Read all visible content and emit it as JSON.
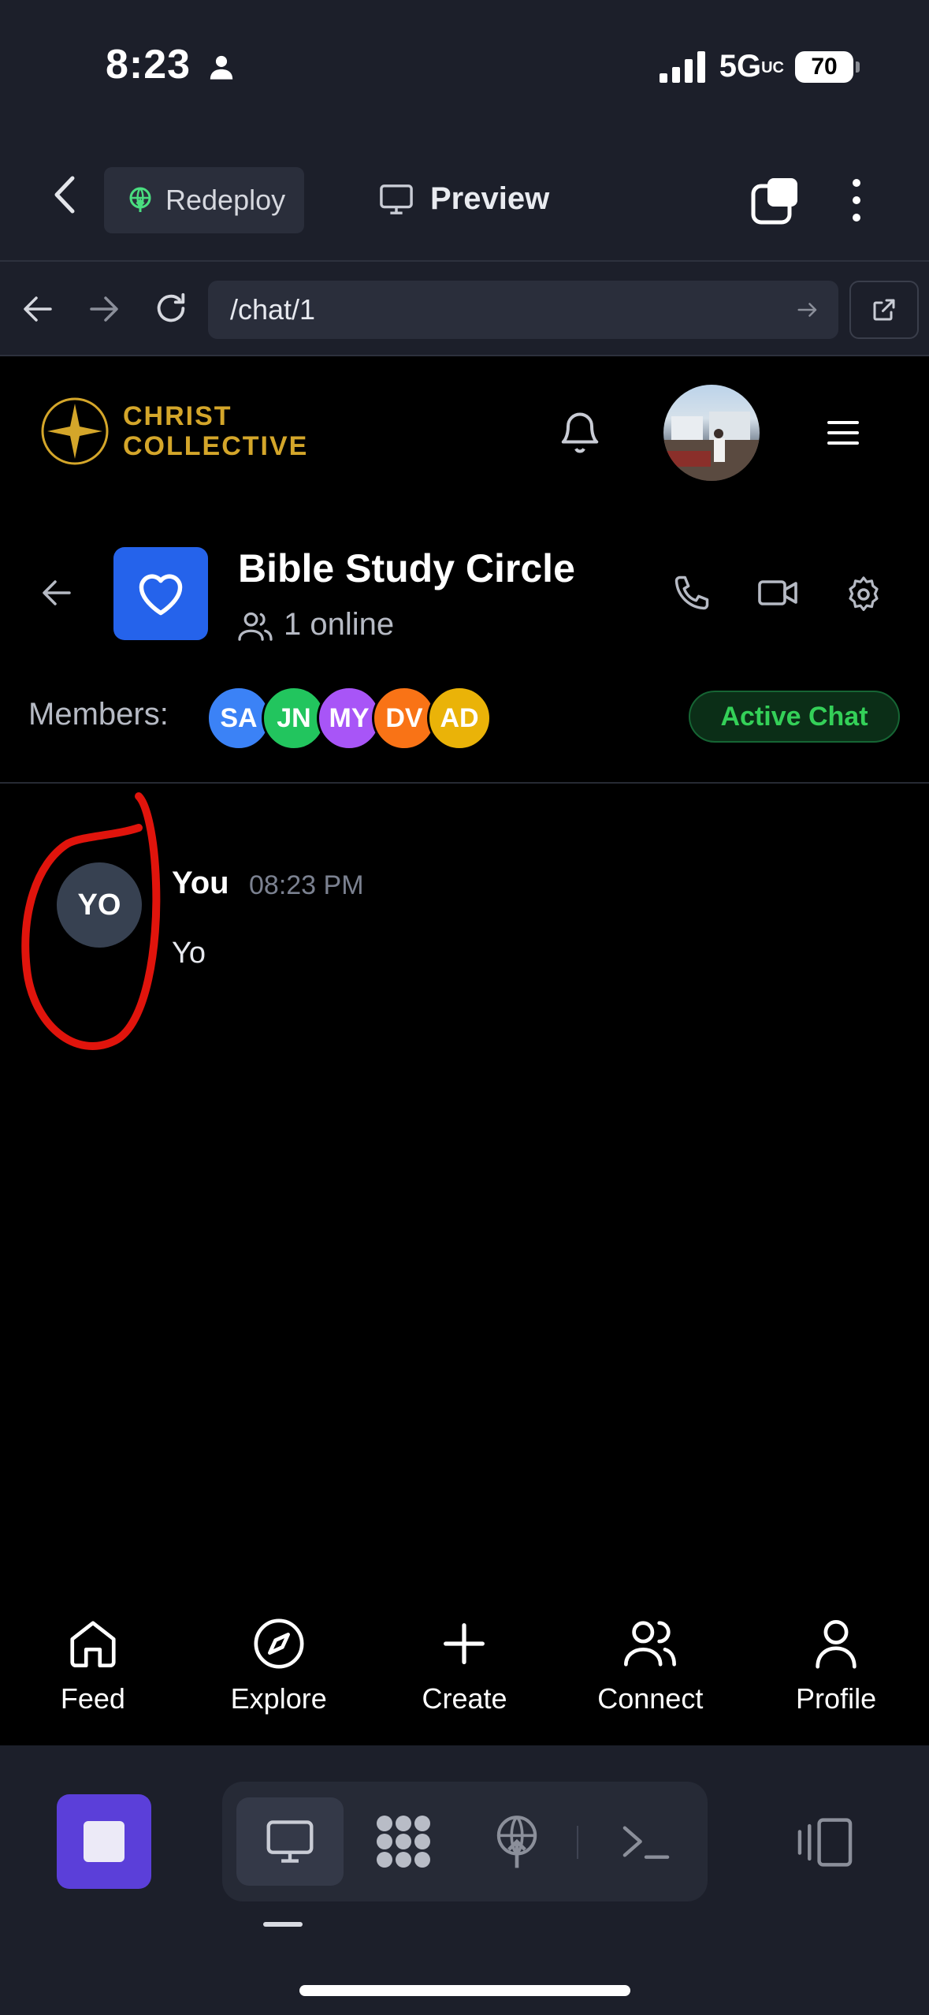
{
  "status_bar": {
    "time": "8:23",
    "network": "5G",
    "network_suffix": "UC",
    "battery": "70"
  },
  "toolbar": {
    "redeploy_label": "Redeploy",
    "preview_label": "Preview"
  },
  "browser": {
    "url": "/chat/1"
  },
  "app_header": {
    "logo_line1": "CHRIST",
    "logo_line2": "COLLECTIVE",
    "brand_color": "#d4a62a"
  },
  "chat": {
    "title": "Bible Study Circle",
    "online_text": "1 online",
    "members_label": "Members:",
    "members": [
      {
        "initials": "SA",
        "color": "#3b82f6"
      },
      {
        "initials": "JN",
        "color": "#22c55e"
      },
      {
        "initials": "MY",
        "color": "#a855f7"
      },
      {
        "initials": "DV",
        "color": "#f97316"
      },
      {
        "initials": "AD",
        "color": "#eab308"
      }
    ],
    "status_badge": "Active Chat"
  },
  "messages": [
    {
      "avatar": "YO",
      "sender": "You",
      "time": "08:23 PM",
      "text": "Yo"
    }
  ],
  "bottom_nav": [
    {
      "label": "Feed",
      "icon": "home-icon"
    },
    {
      "label": "Explore",
      "icon": "compass-icon"
    },
    {
      "label": "Create",
      "icon": "plus-icon"
    },
    {
      "label": "Connect",
      "icon": "users-icon"
    },
    {
      "label": "Profile",
      "icon": "user-icon"
    }
  ],
  "ide_bar": {
    "icons": [
      "stop-icon",
      "monitor-icon",
      "nodes-icon",
      "deploy-icon",
      "terminal-icon",
      "split-view-icon"
    ]
  }
}
